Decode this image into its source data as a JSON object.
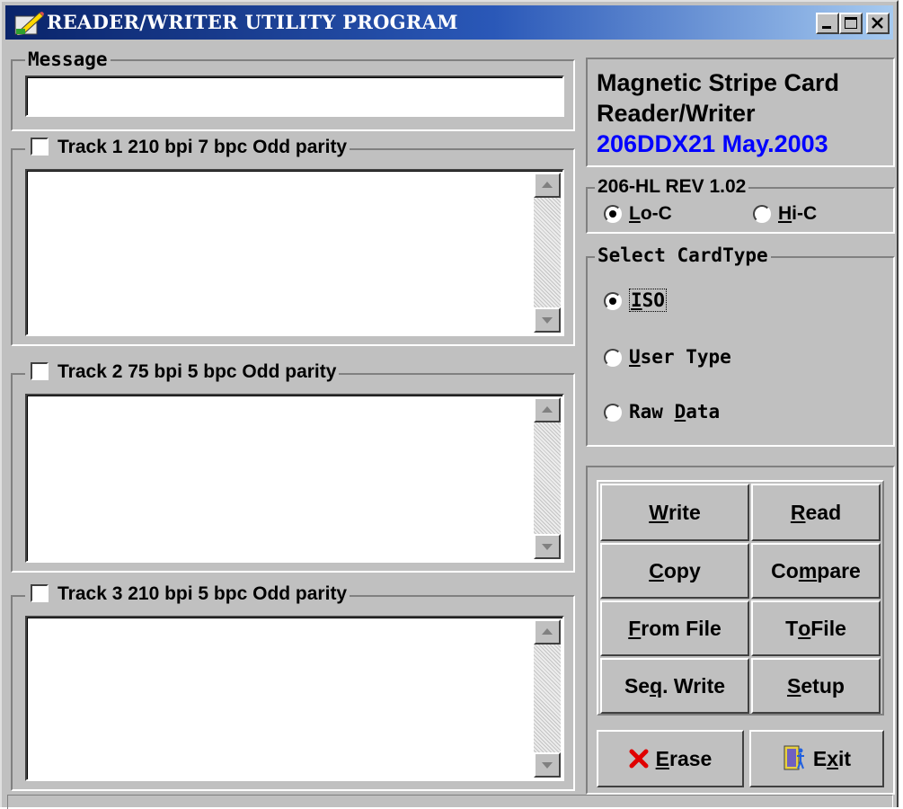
{
  "window": {
    "title": "READER/WRITER UTILITY PROGRAM",
    "controls": {
      "minimize_icon": "minimize-icon",
      "maximize_icon": "maximize-icon",
      "close_icon": "close-icon"
    }
  },
  "message": {
    "label": "Message",
    "value": ""
  },
  "tracks": [
    {
      "label": "Track 1  210 bpi  7 bpc  Odd parity",
      "checked": false,
      "data": ""
    },
    {
      "label": "Track 2  75 bpi  5 bpc  Odd parity",
      "checked": false,
      "data": ""
    },
    {
      "label": "Track 3  210 bpi  5 bpc  Odd parity",
      "checked": false,
      "data": ""
    }
  ],
  "info": {
    "line1": "Magnetic Stripe Card",
    "line2": "Reader/Writer",
    "line3": "206DDX21 May.2003",
    "line3_color": "#0000ff"
  },
  "coercivity": {
    "label": "206-HL REV 1.02",
    "options": [
      {
        "label_underline": "L",
        "label_rest": "o-C",
        "selected": true
      },
      {
        "label_underline": "H",
        "label_rest": "i-C",
        "selected": false
      }
    ]
  },
  "card_type": {
    "label": "Select CardType",
    "options": [
      {
        "pre": "",
        "underline": "I",
        "post": "SO",
        "selected": true
      },
      {
        "pre": "",
        "underline": "U",
        "post": "ser Type",
        "selected": false
      },
      {
        "pre": "Raw ",
        "underline": "D",
        "post": "ata",
        "selected": false
      }
    ]
  },
  "actions": [
    {
      "pre": "",
      "u": "W",
      "post": "rite"
    },
    {
      "pre": "",
      "u": "R",
      "post": "ead"
    },
    {
      "pre": "",
      "u": "C",
      "post": "opy"
    },
    {
      "pre": "Co",
      "u": "m",
      "post": "pare"
    },
    {
      "pre": "",
      "u": "F",
      "post": "rom File"
    },
    {
      "pre": "T",
      "u": "o",
      "post": " File"
    },
    {
      "pre": "Se",
      "u": "q",
      "post": ". Write"
    },
    {
      "pre": "",
      "u": "S",
      "post": "etup"
    }
  ],
  "erase": {
    "pre": "",
    "u": "E",
    "post": "rase",
    "icon": "x-mark-icon",
    "icon_color": "#e00000"
  },
  "exit": {
    "pre": "E",
    "u": "x",
    "post": "it",
    "icon": "door-exit-icon"
  },
  "colors": {
    "face": "#c0c0c0",
    "title_start": "#0a246a",
    "title_end": "#a6caf0"
  }
}
